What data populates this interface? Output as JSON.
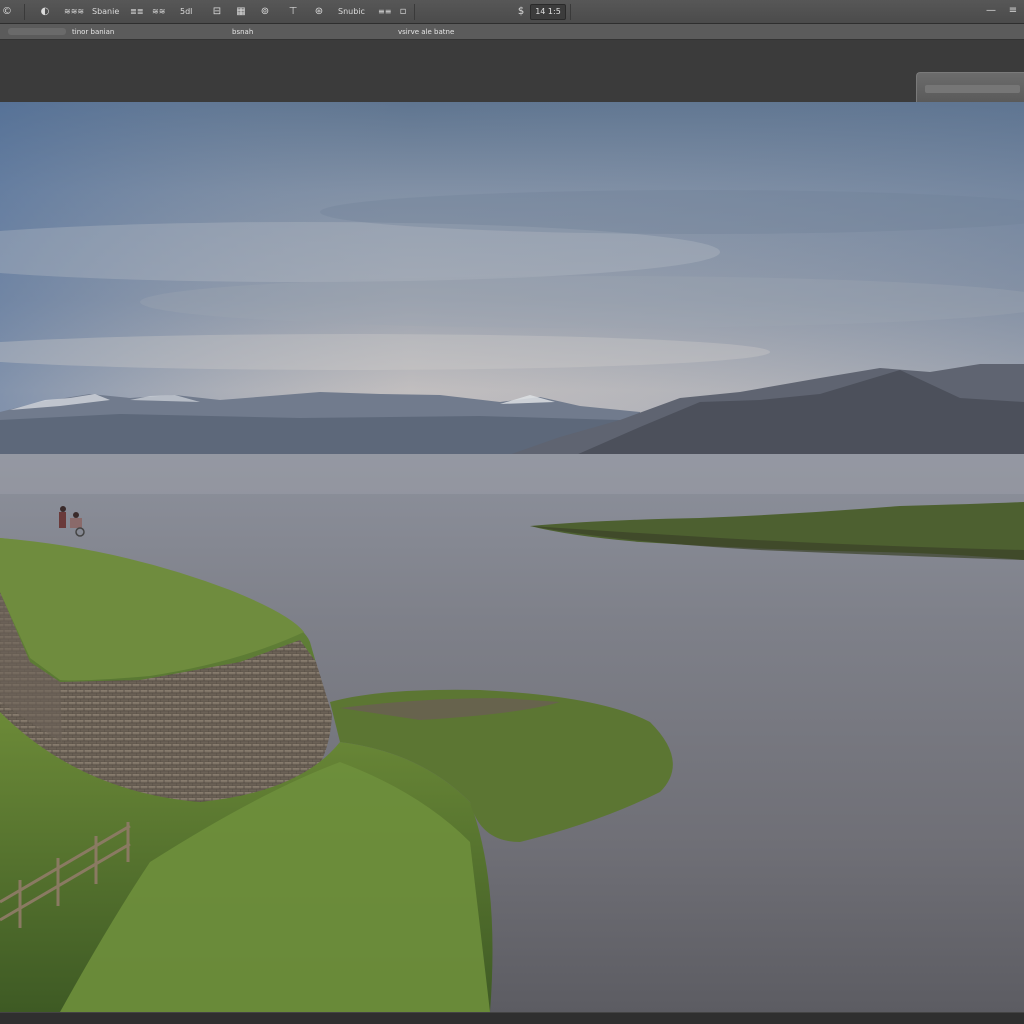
{
  "toolbar": {
    "items": [
      {
        "label": "©"
      },
      {
        "label": "≋≋≋"
      },
      {
        "label": "Sbanie"
      },
      {
        "label": "≣≣"
      },
      {
        "label": "≋≋"
      },
      {
        "label": "5dl"
      },
      {
        "label": "⊟"
      },
      {
        "label": "▦"
      },
      {
        "label": "⊚"
      },
      {
        "label": "⊤"
      },
      {
        "label": "⊛"
      },
      {
        "label": "Snubic"
      },
      {
        "label": "≡≡"
      },
      {
        "label": "▫"
      }
    ],
    "zoom_icon": "$",
    "zoom_value": "14 1:5",
    "minimize_label": "—",
    "menu_label": "≡"
  },
  "options_bar": {
    "items": [
      {
        "label": "tinor banian"
      },
      {
        "label": "bsnah"
      },
      {
        "label": "vsirve ale batne"
      }
    ]
  },
  "canvas": {
    "image_description_icon": "landscape-photo"
  },
  "colors": {
    "toolbar_bg": "#525252",
    "options_bg": "#5b5b5b",
    "workspace_bg": "#3b3b3b"
  }
}
